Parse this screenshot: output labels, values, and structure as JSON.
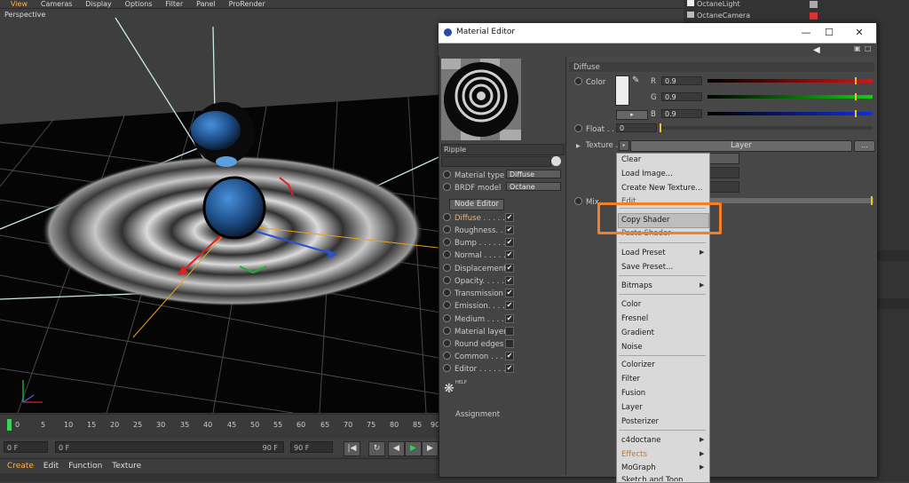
{
  "menubar": {
    "items": [
      "View",
      "Cameras",
      "Display",
      "Options",
      "Filter",
      "Panel",
      "ProRender"
    ]
  },
  "viewport": {
    "label": "Perspective"
  },
  "timeline": {
    "ticks": [
      "0",
      "5",
      "10",
      "15",
      "20",
      "25",
      "30",
      "35",
      "40",
      "45",
      "50",
      "55",
      "60",
      "65",
      "70",
      "75",
      "80",
      "85",
      "90"
    ],
    "start_field": "0 F",
    "range_start": "0 F",
    "range_end": "90 F",
    "end_field": "90 F"
  },
  "bottommenu": {
    "items": [
      "Create",
      "Edit",
      "Function",
      "Texture"
    ]
  },
  "objects": {
    "items": [
      "OctaneLight",
      "OctaneCamera"
    ]
  },
  "window": {
    "title": "Material Editor"
  },
  "material": {
    "name": "Ripple",
    "type_label": "Material type",
    "type_value": "Diffuse",
    "brdf_label": "BRDF model",
    "brdf_value": "Octane",
    "node_editor": "Node Editor",
    "channels": [
      "Diffuse . . . . .",
      "Roughness. . .",
      "Bump . . . . . .",
      "Normal . . . . .",
      "Displacement",
      "Opacity. . . . .",
      "Transmission",
      "Emission. . . .",
      "Medium . . . . .",
      "Material layer",
      "Round edges",
      "Common . . . .",
      "Editor . . . . . ."
    ],
    "assignment": "Assignment",
    "help": "HELP"
  },
  "diffuse": {
    "section": "Diffuse",
    "color_label": "Color",
    "r_label": "R",
    "r_value": "0.9",
    "g_label": "G",
    "g_value": "0.9",
    "b_label": "B",
    "b_value": "0.9",
    "float_label": "Float",
    "float_value": "0",
    "texture_label": "Texture",
    "layer_label": "Layer",
    "more_btn": "...",
    "mix_label": "Mix",
    "edit_label": "Edit"
  },
  "context_menu": {
    "items": {
      "clear": "Clear",
      "load_image": "Load Image...",
      "create_new_texture": "Create New Texture...",
      "copy_shader": "Copy Shader",
      "paste_shader": "Paste Shader",
      "load_preset": "Load Preset",
      "save_preset": "Save Preset...",
      "bitmaps": "Bitmaps",
      "color": "Color",
      "fresnel": "Fresnel",
      "gradient": "Gradient",
      "noise": "Noise",
      "colorizer": "Colorizer",
      "filter": "Filter",
      "fusion": "Fusion",
      "layer": "Layer",
      "posterizer": "Posterizer",
      "c4doctane": "c4doctane",
      "effects": "Effects",
      "mograph": "MoGraph",
      "sketch": "Sketch and Toon"
    }
  },
  "colors": {
    "accent": "#ffb24a",
    "highlight_box": "#f47f24"
  }
}
